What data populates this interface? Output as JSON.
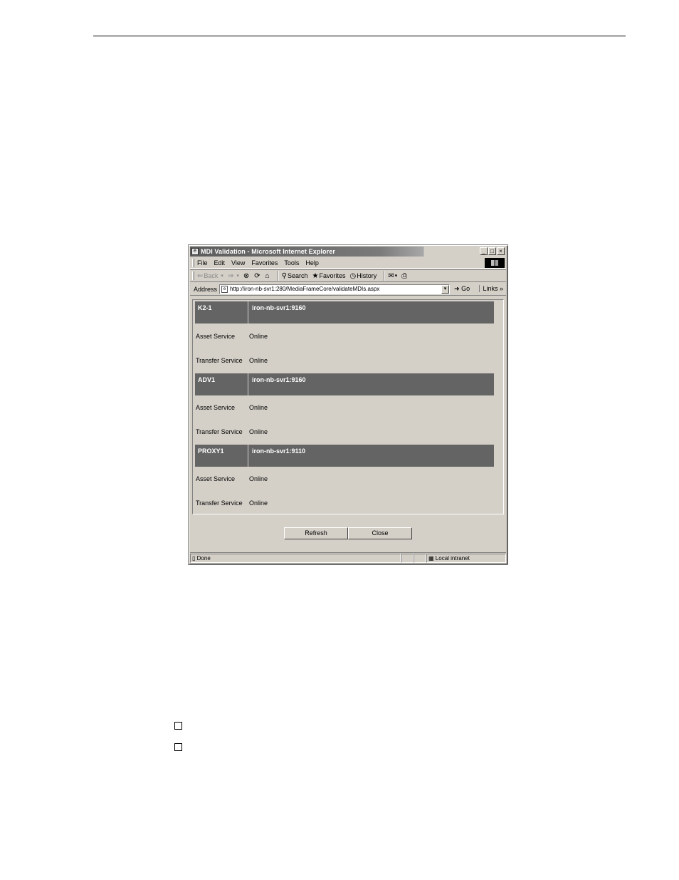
{
  "window": {
    "title": "MDI Validation - Microsoft Internet Explorer",
    "controls": [
      "_",
      "□",
      "×"
    ]
  },
  "menu": [
    "File",
    "Edit",
    "View",
    "Favorites",
    "Tools",
    "Help"
  ],
  "toolbar": {
    "back": "Back",
    "search": "Search",
    "favorites": "Favorites",
    "history": "History"
  },
  "address": {
    "label": "Address",
    "url": "http://iron-nb-svr1:280/MediaFrameCore/validateMDIs.aspx",
    "go": "Go",
    "links": "Links"
  },
  "services": [
    {
      "name": "K2-1",
      "host": "iron-nb-svr1:9160",
      "rows": [
        {
          "label": "Asset Service",
          "status": "Online"
        },
        {
          "label": "Transfer Service",
          "status": "Online"
        }
      ]
    },
    {
      "name": "ADV1",
      "host": "iron-nb-svr1:9160",
      "rows": [
        {
          "label": "Asset Service",
          "status": "Online"
        },
        {
          "label": "Transfer Service",
          "status": "Online"
        }
      ]
    },
    {
      "name": "PROXY1",
      "host": "iron-nb-svr1:9110",
      "rows": [
        {
          "label": "Asset Service",
          "status": "Online"
        },
        {
          "label": "Transfer Service",
          "status": "Online"
        }
      ]
    }
  ],
  "buttons": {
    "refresh": "Refresh",
    "close": "Close"
  },
  "status": {
    "left": "Done",
    "zone": "Local intranet"
  }
}
